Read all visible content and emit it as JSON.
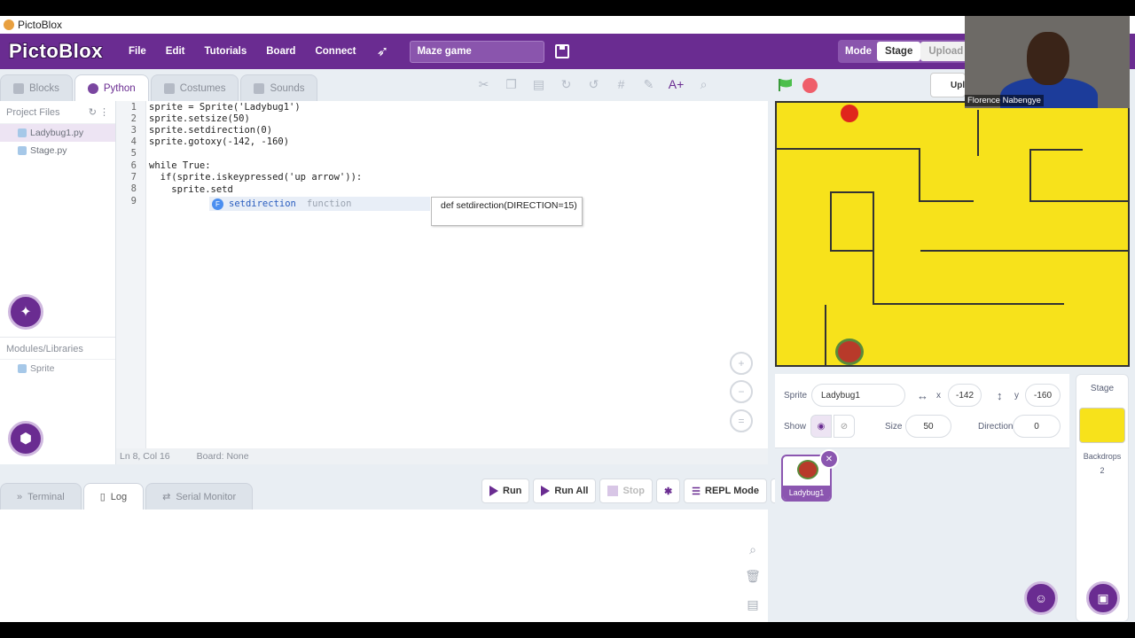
{
  "window": {
    "title": "PictoBlox"
  },
  "menubar": {
    "logo": "PictoBlox",
    "items": [
      "File",
      "Edit",
      "Tutorials",
      "Board",
      "Connect"
    ],
    "project_title": "Maze game",
    "mode_label": "Mode",
    "mode_options": [
      "Stage",
      "Upload"
    ],
    "mode_selected": "Stage"
  },
  "tabs": [
    {
      "label": "Blocks",
      "active": false
    },
    {
      "label": "Python",
      "active": true
    },
    {
      "label": "Costumes",
      "active": false
    },
    {
      "label": "Sounds",
      "active": false
    }
  ],
  "upload_button": "Upl",
  "sidebar": {
    "project_files_label": "Project Files",
    "files": [
      {
        "name": "Ladybug1.py",
        "active": true
      },
      {
        "name": "Stage.py",
        "active": false
      }
    ],
    "modules_label": "Modules/Libraries",
    "modules": [
      "Sprite"
    ]
  },
  "editor": {
    "lines": [
      {
        "n": "1",
        "text": "sprite = Sprite('Ladybug1')"
      },
      {
        "n": "2",
        "text": "sprite.setsize(50)"
      },
      {
        "n": "3",
        "text": "sprite.setdirection(0)"
      },
      {
        "n": "4",
        "text": "sprite.gotoxy(-142, -160)"
      },
      {
        "n": "5",
        "text": ""
      },
      {
        "n": "6",
        "text": "while True:"
      },
      {
        "n": "7",
        "text": "  if(sprite.iskeypressed('up arrow')):"
      },
      {
        "n": "8",
        "text": "    sprite.setd"
      },
      {
        "n": "9",
        "text": ""
      }
    ],
    "autocomplete": {
      "badge": "F",
      "name": "setdirection",
      "type": "function"
    },
    "tooltip": "def setdirection(DIRECTION=15)",
    "status": {
      "position": "Ln 8, Col 16",
      "board": "Board: None"
    }
  },
  "bottom": {
    "tabs": [
      {
        "label": "Terminal",
        "active": false
      },
      {
        "label": "Log",
        "active": true
      },
      {
        "label": "Serial Monitor",
        "active": false
      }
    ],
    "run": "Run",
    "run_all": "Run All",
    "stop": "Stop",
    "repl": "REPL Mode"
  },
  "sprite_info": {
    "sprite_label": "Sprite",
    "sprite_name": "Ladybug1",
    "x_label": "x",
    "x": "-142",
    "y_label": "y",
    "y": "-160",
    "show_label": "Show",
    "size_label": "Size",
    "size": "50",
    "direction_label": "Direction",
    "direction": "0"
  },
  "sprites": [
    {
      "name": "Ladybug1"
    }
  ],
  "stage_panel": {
    "title": "Stage",
    "backdrops_label": "Backdrops",
    "backdrops_count": "2"
  },
  "webcam": {
    "name": "Florence Nabengye"
  },
  "colors": {
    "accent": "#6a2c91",
    "stage_bg": "#f7e21b",
    "wall": "#333333"
  }
}
